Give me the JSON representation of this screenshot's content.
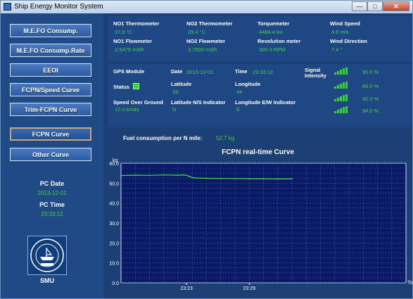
{
  "window": {
    "title": "Ship Energy Monitor System"
  },
  "sidebar": {
    "buttons": [
      {
        "label": "M.E.FO Consump."
      },
      {
        "label": "M.E.FO Consump.Rate"
      },
      {
        "label": "EEOI"
      },
      {
        "label": "FCPN/Speed Curve"
      },
      {
        "label": "Trim-FCPN Curve"
      },
      {
        "label": "FCPN Curve"
      },
      {
        "label": "Other Curve"
      }
    ],
    "pc_date_label": "PC Date",
    "pc_date_value": "2013-12-01",
    "pc_time_label": "PC Time",
    "pc_time_value": "23:33:12",
    "logo_caption": "SMU"
  },
  "sensors": {
    "no1_thermo_label": "NO1 Thermometer",
    "no1_thermo_value": "37.9 °C",
    "no2_thermo_label": "NO2 Thermometer",
    "no2_thermo_value": "29.4 °C",
    "torque_label": "Torquemeter",
    "torque_value": "4484.4 kw",
    "wind_speed_label": "Wind Speed",
    "wind_speed_value": "4.6 m/s",
    "no1_flow_label": "NO1 Flowmeter",
    "no1_flow_value": "2.5475 m3/h",
    "no2_flow_label": "NO2 Flowmeter",
    "no2_flow_value": "3.7500 m3/h",
    "rev_label": "Revolution meter",
    "rev_value": "300.3 RPM",
    "wind_dir_label": "Wind Direction",
    "wind_dir_value": "7.4 °"
  },
  "gps": {
    "module_label": "GPS Module",
    "date_label": "Date",
    "date_value": "2013-12-01",
    "time_label": "Time",
    "time_value": "23:33:12",
    "signal_label": "Signal Intensity",
    "status_label": "Status",
    "lat_label": "Latitude",
    "lat_value": "33",
    "lon_label": "Longitude",
    "lon_value": "44",
    "sog_label": "Speed Over Ground",
    "sog_value": "12.0 knots",
    "lat_ind_label": "Latitude N/S Indicator",
    "lat_ind_value": "N",
    "lon_ind_label": "Longitude E/W Indicator",
    "lon_ind_value": "E",
    "signals": [
      "90.0 %",
      "89.0 %",
      "92.0 %",
      "94.0 %"
    ]
  },
  "fuel": {
    "label": "Fuel consumption per N mile:",
    "value": "52.7 kg"
  },
  "colors": {
    "background": "#1c3f75",
    "panel": "#1f4784",
    "value_green": "#42d441",
    "plot_bg": "#0a1a66",
    "series": "#3fe33f"
  },
  "chart_data": {
    "type": "line",
    "title": "FCPN real-time Curve",
    "ylabel": "kg",
    "xlabel": "Time",
    "ylim": [
      0,
      60
    ],
    "yticks": [
      "0.0",
      "10.0",
      "20.0",
      "30.0",
      "40.0",
      "50.0",
      "60.0"
    ],
    "xticks": [
      {
        "t": 0.23,
        "label": "23:23"
      },
      {
        "t": 0.45,
        "label": "23:29"
      }
    ],
    "series": [
      {
        "values": [
          [
            0.0,
            53.8
          ],
          [
            0.05,
            54.0
          ],
          [
            0.1,
            53.9
          ],
          [
            0.15,
            54.1
          ],
          [
            0.2,
            54.0
          ],
          [
            0.22,
            54.1
          ],
          [
            0.23,
            53.9
          ],
          [
            0.24,
            53.4
          ],
          [
            0.25,
            52.8
          ],
          [
            0.26,
            52.6
          ],
          [
            0.3,
            52.4
          ],
          [
            0.35,
            52.3
          ],
          [
            0.4,
            52.3
          ],
          [
            0.45,
            52.2
          ],
          [
            0.5,
            52.2
          ],
          [
            0.55,
            52.1
          ],
          [
            0.6,
            52.2
          ]
        ]
      }
    ],
    "grid": true
  }
}
